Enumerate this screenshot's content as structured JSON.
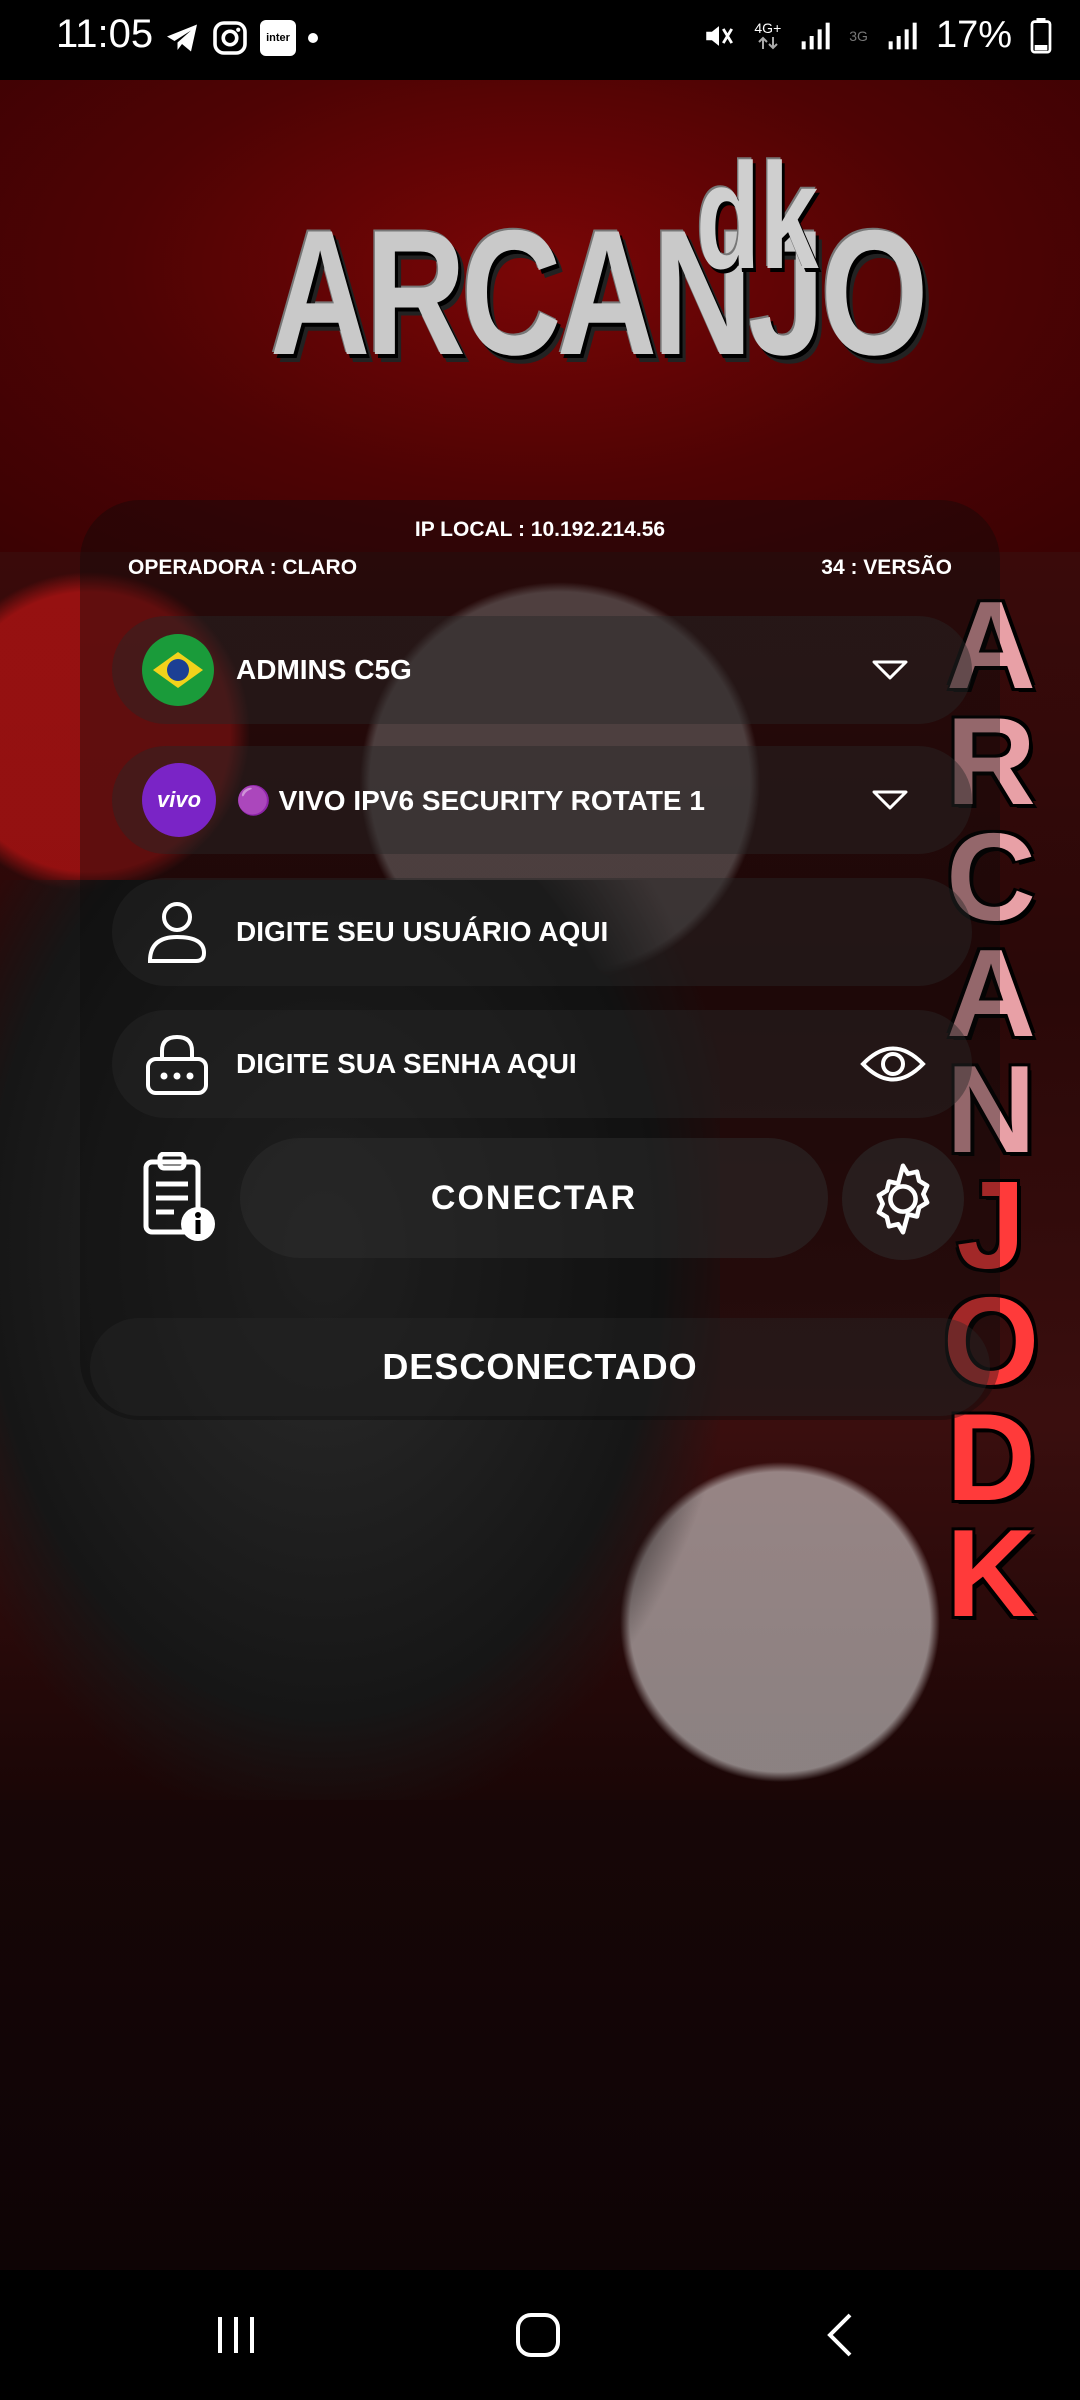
{
  "status_bar": {
    "time": "11:05",
    "left_icons": [
      "telegram-icon",
      "instagram-icon",
      "inter-icon",
      "dot-icon"
    ],
    "inter_label": "inter",
    "network_1": "4G+",
    "network_2": "3G",
    "battery": "17%"
  },
  "logo": {
    "main": "ARCANJO",
    "sup": "dk"
  },
  "info": {
    "ip_local": "IP LOCAL :  10.192.214.56",
    "operadora": "OPERADORA :  CLARO",
    "versao": "34  : VERSÃO"
  },
  "server_select": {
    "label": "ADMINS C5G",
    "icon": "brazil-flag-icon"
  },
  "payload_select": {
    "label": "🟣 VIVO IPV6 SECURITY ROTATE 1",
    "icon": "vivo-icon",
    "icon_text": "vivo"
  },
  "username_field": {
    "placeholder": "DIGITE SEU USUÁRIO AQUI"
  },
  "password_field": {
    "placeholder": "DIGITE SUA SENHA AQUI"
  },
  "connect_button": {
    "label": "CONECTAR"
  },
  "status": {
    "text": "DESCONECTADO"
  },
  "background_side_text": [
    "A",
    "R",
    "C",
    "A",
    "N",
    "J",
    "O",
    "D",
    "K"
  ],
  "colors": {
    "header_red": "#5a0405",
    "accent_purple": "#7a24c6",
    "nav_bg": "#000000"
  }
}
